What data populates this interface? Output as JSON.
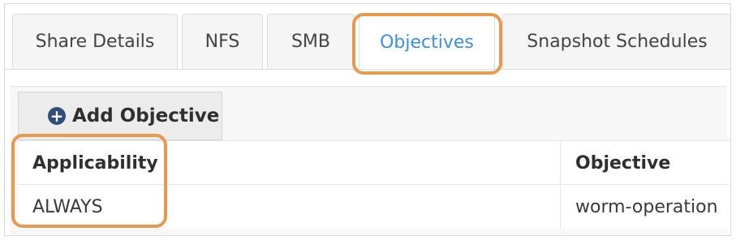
{
  "tabs": [
    {
      "label": "Share Details",
      "active": false
    },
    {
      "label": "NFS",
      "active": false
    },
    {
      "label": "SMB",
      "active": false
    },
    {
      "label": "Objectives",
      "active": true
    },
    {
      "label": "Snapshot Schedules",
      "active": false
    }
  ],
  "toolbar": {
    "add_objective_label": "Add Objective",
    "add_icon": "plus-circle-icon"
  },
  "table": {
    "columns": [
      "Applicability",
      "Objective"
    ],
    "rows": [
      [
        "ALWAYS",
        "worm-operation"
      ]
    ]
  },
  "colors": {
    "highlight": "#e59a4d",
    "active_tab_text": "#3a8ee6",
    "add_icon": "#2e4e7c"
  }
}
